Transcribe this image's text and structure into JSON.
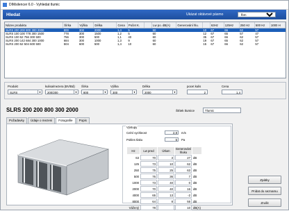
{
  "window": {
    "title": "DIMsilencer 6.0 - Vyhledat tlumic"
  },
  "banner": {
    "heading": "Hledat",
    "band_label": "Ukázat oktávové pásmo",
    "band_value": "fbm"
  },
  "grid": {
    "columns": [
      "Název produktu",
      "Šírka",
      "Výška",
      "Délka",
      "Cena",
      "Počet K.",
      "",
      "Lw po. dB(A)",
      "Generování hlu.",
      "",
      "63Hz",
      "125Hz",
      "250 Hz",
      "500 Hz",
      "1000 H"
    ],
    "rows": [
      [
        "SLRS 200 200 800 300 2000",
        "800",
        "300",
        "2000",
        "1,4",
        "5",
        "",
        "50",
        "",
        "10",
        "67",
        "66",
        "62",
        "57",
        ""
      ],
      [
        "SLRS 100 100 778 300 1500",
        "778",
        "300",
        "1500",
        "1,2",
        "5",
        "",
        "60",
        "",
        "12",
        "67",
        "65",
        "57",
        "47",
        ""
      ],
      [
        "SLRS 100 52 756 300 500",
        "756",
        "300",
        "500",
        "1,1",
        "40",
        "",
        "60",
        "",
        "35",
        "67",
        "66",
        "62",
        "57",
        ""
      ],
      [
        "SLRS 200 142 684 300 1000",
        "684",
        "300",
        "1000",
        "1,3",
        "9",
        "",
        "60",
        "",
        "19",
        "67",
        "65",
        "62",
        "57",
        ""
      ],
      [
        "SLRS 200 52 504 600 500",
        "504",
        "600",
        "500",
        "1,4",
        "10",
        "",
        "60",
        "",
        "15",
        "67",
        "66",
        "62",
        "57",
        ""
      ]
    ]
  },
  "filters": [
    {
      "label": "Produkt",
      "value": "SLRS"
    },
    {
      "label": "kulisa/mezera (BV/Bd)",
      "value": "200/200"
    },
    {
      "label": "Šírka",
      "value": "800"
    },
    {
      "label": "Výška",
      "value": "300"
    },
    {
      "label": "Délka",
      "value": "2000"
    },
    {
      "label": "pocet kulis",
      "value": "2"
    },
    {
      "label": "Cena",
      "value": "1,4"
    }
  ],
  "product": {
    "title": "SLRS 200 200 800 300 2000",
    "label_caption": "Štítek tlumice",
    "label_value": "Tlumic"
  },
  "tabs": [
    "Požadavky",
    "Údaje o mezeni",
    "Fotografie",
    "Popis"
  ],
  "vystup": {
    "group_label": "Výstupy",
    "ztrata_label": "Celní vychleost",
    "ztrata_value": "2,9",
    "ztrata_unit": "m/s",
    "pocet_label": "Pokles tlaku",
    "pocet_value": "5",
    "pocet_unit": "Pa",
    "headers": [
      "Hz",
      "Lw pred",
      "Útlum",
      "Generování hluku"
    ],
    "rows": [
      {
        "hz": "63",
        "a": "70",
        "b": "3",
        "c": "27",
        "u": "dB"
      },
      {
        "hz": "125",
        "a": "73",
        "b": "10",
        "c": "62",
        "u": "dB"
      },
      {
        "hz": "250",
        "a": "75",
        "b": "25",
        "c": "63",
        "u": "dB"
      },
      {
        "hz": "500",
        "a": "76",
        "b": "36",
        "c": "7",
        "u": "dB"
      },
      {
        "hz": "1000",
        "a": "73",
        "b": "40",
        "c": "0",
        "u": "dB"
      },
      {
        "hz": "2000",
        "a": "70",
        "b": "40",
        "c": "16",
        "u": "dB"
      },
      {
        "hz": "4000",
        "a": "65",
        "b": "13",
        "c": "-2",
        "u": "dB"
      },
      {
        "hz": "8000",
        "a": "64",
        "b": "8",
        "c": "55",
        "u": "dB"
      },
      {
        "hz": "Vážený",
        "a": "78",
        "b": "",
        "c": "10",
        "u": "dB(A)"
      }
    ]
  },
  "buttons": {
    "back": "Zpátky",
    "add": "Pridat do seznamu",
    "close": "Zrušit"
  }
}
